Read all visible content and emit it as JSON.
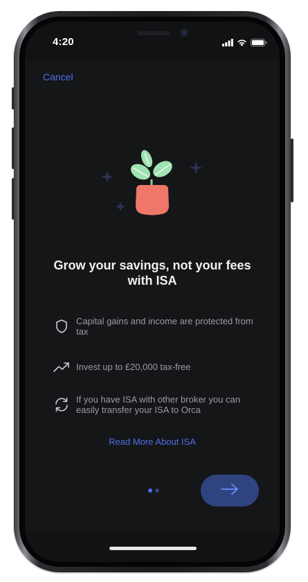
{
  "status_bar": {
    "time": "4:20",
    "icons": [
      "cellular-signal-icon",
      "wifi-icon",
      "battery-icon"
    ]
  },
  "nav": {
    "cancel_label": "Cancel"
  },
  "onboarding": {
    "title": "Grow your savings, not your fees with ISA",
    "features": [
      {
        "icon": "shield-icon",
        "text": "Capital gains and income are protected from tax"
      },
      {
        "icon": "trending-up-icon",
        "text": "Invest up to £20,000 tax-free"
      },
      {
        "icon": "transfer-arrows-icon",
        "text": "If you have ISA with other broker you can easily transfer your ISA to Orca"
      }
    ],
    "read_more_label": "Read More About ISA",
    "pager": {
      "total": 2,
      "active_index": 0
    },
    "next_button_icon": "arrow-right-icon"
  },
  "colors": {
    "accent": "#4f6ee8",
    "next_button_bg": "#2f437f",
    "screen_bg": "#151618",
    "title_text": "#f1f1f3",
    "body_text": "#9a9ca3",
    "pager_active": "#4f6ee8",
    "pager_inactive": "#2f437f",
    "pot": "#ef7769",
    "leaf": "#9fe3b3"
  }
}
